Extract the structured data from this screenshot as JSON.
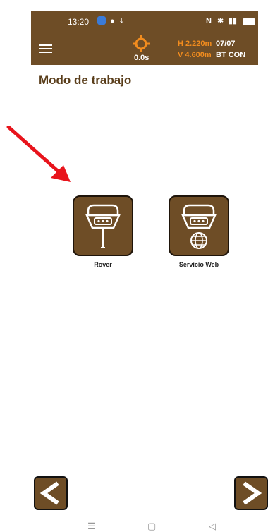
{
  "status_bar": {
    "time": "13:20",
    "icons": [
      "notification-icon",
      "location-icon",
      "download-icon",
      "nfc-icon",
      "bluetooth-icon",
      "signal-icon",
      "battery-icon"
    ]
  },
  "toolbar": {
    "menu_icon": "hamburger-icon",
    "target_icon": "crosshair-icon",
    "timer": "0.0s",
    "h_accuracy": "H 2.220m",
    "v_accuracy": "V 4.600m",
    "satellites": "07/07",
    "connection": "BT CON",
    "accent_color": "#f28c1e",
    "bar_color": "#6e4d26"
  },
  "page_title": "Modo de trabajo",
  "modes": [
    {
      "label": "Rover",
      "icon": "gnss-receiver-pole-icon"
    },
    {
      "label": "Servicio Web",
      "icon": "gnss-receiver-globe-icon"
    }
  ],
  "annotation": {
    "icon": "red-arrow-icon",
    "color": "#e8141c"
  },
  "nav": {
    "back_icon": "chevron-left-icon",
    "next_icon": "chevron-right-icon"
  },
  "system_nav": {
    "menu": "☰",
    "home": "▢",
    "back": "◁"
  }
}
